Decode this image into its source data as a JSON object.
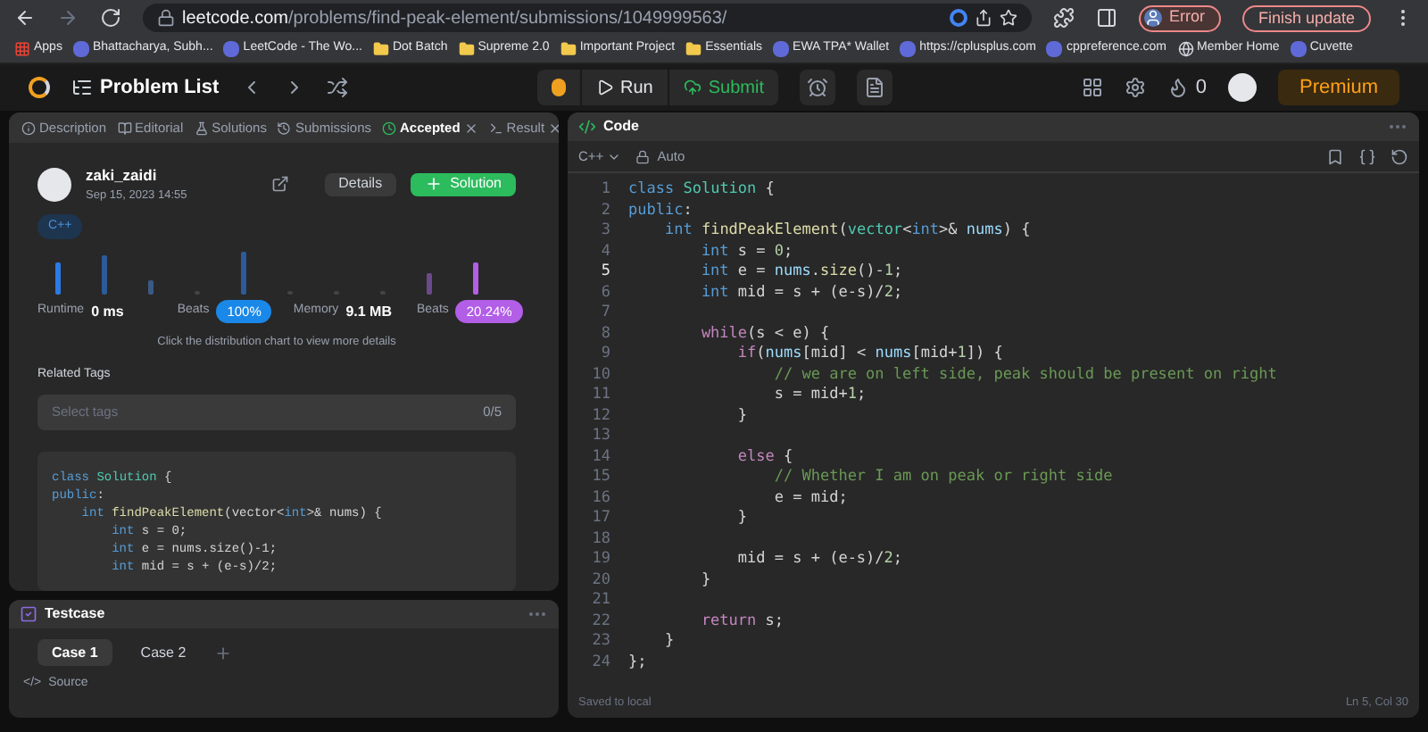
{
  "browser": {
    "url_domain": "leetcode.com",
    "url_path": "/problems/find-peak-element/submissions/1049999563/",
    "profile_label": "Error",
    "update_button": "Finish update",
    "bookmarks": [
      {
        "label": "Apps",
        "kind": "apps"
      },
      {
        "label": "Bhattacharya, Subh...",
        "kind": "site"
      },
      {
        "label": "LeetCode - The Wo...",
        "kind": "site"
      },
      {
        "label": "Dot Batch",
        "kind": "folder"
      },
      {
        "label": "Supreme 2.0",
        "kind": "folder"
      },
      {
        "label": "Important Project",
        "kind": "folder"
      },
      {
        "label": "Essentials",
        "kind": "folder"
      },
      {
        "label": "EWA TPA* Wallet",
        "kind": "site"
      },
      {
        "label": "https://cplusplus.com",
        "kind": "site"
      },
      {
        "label": "cppreference.com",
        "kind": "site"
      },
      {
        "label": "Member Home",
        "kind": "globe"
      },
      {
        "label": "Cuvette",
        "kind": "site"
      }
    ]
  },
  "app_nav": {
    "title": "Problem List",
    "run": "Run",
    "submit": "Submit",
    "streak": "0",
    "premium": "Premium"
  },
  "left_tabs": [
    {
      "label": "Description",
      "selected": false,
      "closable": false
    },
    {
      "label": "Editorial",
      "selected": false,
      "closable": false
    },
    {
      "label": "Solutions",
      "selected": false,
      "closable": false
    },
    {
      "label": "Submissions",
      "selected": false,
      "closable": false
    },
    {
      "label": "Accepted",
      "selected": true,
      "closable": true
    },
    {
      "label": "Result",
      "selected": false,
      "closable": true
    }
  ],
  "submission": {
    "user": "zaki_zaidi",
    "date": "Sep 15, 2023 14:55",
    "details_button": "Details",
    "solution_button": "Solution",
    "language": "C++",
    "runtime_label": "Runtime",
    "runtime_value": "0 ms",
    "runtime_beats_label": "Beats",
    "runtime_beats": "100%",
    "memory_label": "Memory",
    "memory_value": "9.1 MB",
    "memory_beats_label": "Beats",
    "memory_beats": "20.24%",
    "hint": "Click the distribution chart to view more details"
  },
  "related_tags": {
    "heading": "Related Tags",
    "placeholder": "Select tags",
    "count": "0/5"
  },
  "code_preview": [
    [
      {
        "kind": "kw",
        "text": "class "
      },
      {
        "kind": "type",
        "text": "Solution"
      },
      {
        "kind": "p",
        "text": " {"
      }
    ],
    [
      {
        "kind": "kw",
        "text": "public"
      },
      {
        "kind": "p",
        "text": ":"
      }
    ],
    [
      {
        "kind": "kw",
        "text": "    int "
      },
      {
        "kind": "fn",
        "text": "findPeakElement"
      },
      {
        "kind": "p",
        "text": "(vector<"
      },
      {
        "kind": "kw",
        "text": "int"
      },
      {
        "kind": "p",
        "text": ">& nums) {"
      }
    ],
    [
      {
        "kind": "kw",
        "text": "        int "
      },
      {
        "kind": "p",
        "text": "s = 0;"
      }
    ],
    [
      {
        "kind": "kw",
        "text": "        int "
      },
      {
        "kind": "p",
        "text": "e = nums.size()-1;"
      }
    ],
    [
      {
        "kind": "kw",
        "text": "        int "
      },
      {
        "kind": "p",
        "text": "mid = s + (e-s)/2;"
      }
    ]
  ],
  "testcase": {
    "title": "Testcase",
    "cases": [
      {
        "label": "Case 1",
        "selected": true
      },
      {
        "label": "Case 2",
        "selected": false
      }
    ],
    "source_icon": "</>",
    "source": "Source"
  },
  "editor": {
    "title": "Code",
    "language": "C++",
    "mode": "Auto",
    "status_left": "Saved to local",
    "status_right": "Ln 5, Col 30",
    "lines": [
      {
        "number": "1",
        "current": false,
        "tokens": [
          {
            "kind": "kw",
            "text": "class "
          },
          {
            "kind": "type",
            "text": "Solution"
          },
          {
            "kind": "p",
            "text": " {"
          }
        ]
      },
      {
        "number": "2",
        "current": false,
        "tokens": [
          {
            "kind": "kw",
            "text": "public"
          },
          {
            "kind": "p",
            "text": ":"
          }
        ]
      },
      {
        "number": "3",
        "current": false,
        "tokens": [
          {
            "kind": "kw",
            "text": "    int "
          },
          {
            "kind": "fn",
            "text": "findPeakElement"
          },
          {
            "kind": "p",
            "text": "("
          },
          {
            "kind": "type",
            "text": "vector"
          },
          {
            "kind": "p",
            "text": "<"
          },
          {
            "kind": "kw",
            "text": "int"
          },
          {
            "kind": "p",
            "text": ">& "
          },
          {
            "kind": "var",
            "text": "nums"
          },
          {
            "kind": "p",
            "text": ") {"
          }
        ]
      },
      {
        "number": "4",
        "current": false,
        "tokens": [
          {
            "kind": "kw",
            "text": "        int "
          },
          {
            "kind": "p",
            "text": "s = "
          },
          {
            "kind": "num",
            "text": "0"
          },
          {
            "kind": "p",
            "text": ";"
          }
        ]
      },
      {
        "number": "5",
        "current": true,
        "tokens": [
          {
            "kind": "kw",
            "text": "        int "
          },
          {
            "kind": "p",
            "text": "e = "
          },
          {
            "kind": "var",
            "text": "nums"
          },
          {
            "kind": "p",
            "text": "."
          },
          {
            "kind": "fn",
            "text": "size"
          },
          {
            "kind": "p",
            "text": "()-"
          },
          {
            "kind": "num",
            "text": "1"
          },
          {
            "kind": "p",
            "text": ";"
          }
        ]
      },
      {
        "number": "6",
        "current": false,
        "tokens": [
          {
            "kind": "kw",
            "text": "        int "
          },
          {
            "kind": "p",
            "text": "mid = s + (e-s)/"
          },
          {
            "kind": "num",
            "text": "2"
          },
          {
            "kind": "p",
            "text": ";"
          }
        ]
      },
      {
        "number": "7",
        "current": false
      },
      {
        "number": "8",
        "current": false,
        "tokens": [
          {
            "kind": "ctrl",
            "text": "        while"
          },
          {
            "kind": "p",
            "text": "(s < e) {"
          }
        ]
      },
      {
        "number": "9",
        "current": false,
        "tokens": [
          {
            "kind": "ctrl",
            "text": "            if"
          },
          {
            "kind": "p",
            "text": "("
          },
          {
            "kind": "var",
            "text": "nums"
          },
          {
            "kind": "p",
            "text": "[mid] < "
          },
          {
            "kind": "var",
            "text": "nums"
          },
          {
            "kind": "p",
            "text": "[mid+"
          },
          {
            "kind": "num",
            "text": "1"
          },
          {
            "kind": "p",
            "text": "]) {"
          }
        ]
      },
      {
        "number": "10",
        "current": false,
        "tokens": [
          {
            "kind": "comment",
            "text": "                // we are on left side, peak should be present on right"
          }
        ]
      },
      {
        "number": "11",
        "current": false,
        "tokens": [
          {
            "kind": "p",
            "text": "                s = mid+"
          },
          {
            "kind": "num",
            "text": "1"
          },
          {
            "kind": "p",
            "text": ";"
          }
        ]
      },
      {
        "number": "12",
        "current": false,
        "tokens": [
          {
            "kind": "p",
            "text": "            }"
          }
        ]
      },
      {
        "number": "13",
        "current": false
      },
      {
        "number": "14",
        "current": false,
        "tokens": [
          {
            "kind": "ctrl",
            "text": "            else"
          },
          {
            "kind": "p",
            "text": " {"
          }
        ]
      },
      {
        "number": "15",
        "current": false,
        "tokens": [
          {
            "kind": "comment",
            "text": "                // Whether I am on peak or right side"
          }
        ]
      },
      {
        "number": "16",
        "current": false,
        "tokens": [
          {
            "kind": "p",
            "text": "                e = mid;"
          }
        ]
      },
      {
        "number": "17",
        "current": false,
        "tokens": [
          {
            "kind": "p",
            "text": "            }"
          }
        ]
      },
      {
        "number": "18",
        "current": false
      },
      {
        "number": "19",
        "current": false,
        "tokens": [
          {
            "kind": "p",
            "text": "            mid = s + (e-s)/"
          },
          {
            "kind": "num",
            "text": "2"
          },
          {
            "kind": "p",
            "text": ";"
          }
        ]
      },
      {
        "number": "20",
        "current": false,
        "tokens": [
          {
            "kind": "p",
            "text": "        }"
          }
        ]
      },
      {
        "number": "21",
        "current": false
      },
      {
        "number": "22",
        "current": false,
        "tokens": [
          {
            "kind": "ctrl",
            "text": "        return"
          },
          {
            "kind": "p",
            "text": " s;"
          }
        ]
      },
      {
        "number": "23",
        "current": false,
        "tokens": [
          {
            "kind": "p",
            "text": "    }"
          }
        ]
      },
      {
        "number": "24",
        "current": false,
        "tokens": [
          {
            "kind": "p",
            "text": "};"
          }
        ]
      }
    ]
  }
}
